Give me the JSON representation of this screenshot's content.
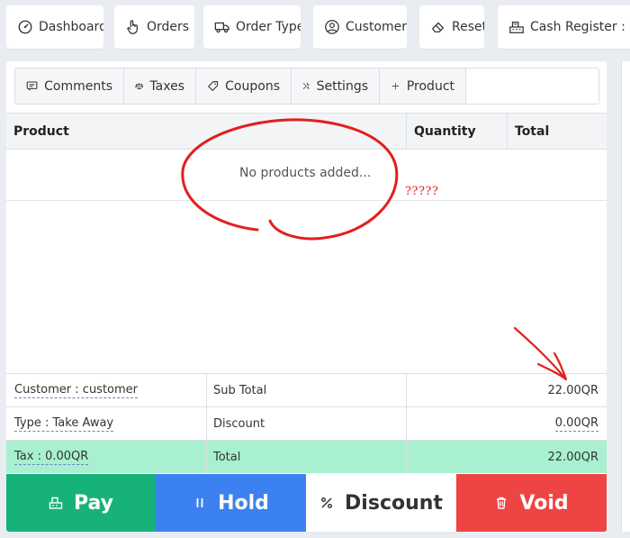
{
  "nav": [
    {
      "label": "Dashboard",
      "icon": "dashboard-icon"
    },
    {
      "label": "Orders",
      "icon": "pointer-hand-icon"
    },
    {
      "label": "Order Type",
      "icon": "truck-icon"
    },
    {
      "label": "Customers",
      "icon": "user-circle-icon"
    },
    {
      "label": "Reset",
      "icon": "eraser-icon"
    },
    {
      "label": "Cash Register : reg",
      "icon": "cash-register-icon"
    }
  ],
  "toolbar": [
    {
      "label": "Comments",
      "icon": "comment-icon"
    },
    {
      "label": "Taxes",
      "icon": "scale-icon"
    },
    {
      "label": "Coupons",
      "icon": "tag-icon"
    },
    {
      "label": "Settings",
      "icon": "tools-icon"
    },
    {
      "label": "Product",
      "icon": "plus-icon"
    }
  ],
  "table": {
    "headers": [
      "Product",
      "Quantity",
      "Total"
    ],
    "empty_text": "No products added..."
  },
  "summary": {
    "customer": "Customer : customer",
    "type": "Type : Take Away",
    "tax": "Tax : 0.00QR",
    "subtotal_label": "Sub Total",
    "subtotal_value": "22.00QR",
    "discount_label": "Discount",
    "discount_value": "0.00QR",
    "total_label": "Total",
    "total_value": "22.00QR"
  },
  "actions": {
    "pay": "Pay",
    "hold": "Hold",
    "discount": "Discount",
    "void": "Void"
  },
  "annotation": {
    "question_marks": "?????",
    "color": "#e11d1d"
  }
}
